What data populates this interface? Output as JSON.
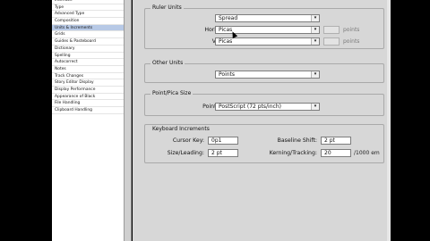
{
  "sidebar": {
    "items": [
      {
        "label": "Interface",
        "selected": false
      },
      {
        "label": "Type",
        "selected": false
      },
      {
        "label": "Advanced Type",
        "selected": false
      },
      {
        "label": "Composition",
        "selected": false
      },
      {
        "label": "Units & Increments",
        "selected": true
      },
      {
        "label": "Grids",
        "selected": false
      },
      {
        "label": "Guides & Pasteboard",
        "selected": false
      },
      {
        "label": "Dictionary",
        "selected": false
      },
      {
        "label": "Spelling",
        "selected": false
      },
      {
        "label": "Autocorrect",
        "selected": false
      },
      {
        "label": "Notes",
        "selected": false
      },
      {
        "label": "Track Changes",
        "selected": false
      },
      {
        "label": "Story Editor Display",
        "selected": false
      },
      {
        "label": "Display Performance",
        "selected": false
      },
      {
        "label": "Appearance of Black",
        "selected": false
      },
      {
        "label": "File Handling",
        "selected": false
      },
      {
        "label": "Clipboard Handling",
        "selected": false
      }
    ]
  },
  "ruler_units": {
    "title": "Ruler Units",
    "origin_label": "Origin:",
    "origin_value": "Spread",
    "horizontal_label": "Horizontal:",
    "horizontal_value": "Picas",
    "horizontal_unit": "points",
    "vertical_label": "Vertical:",
    "vertical_value": "Picas",
    "vertical_unit": "points"
  },
  "other_units": {
    "title": "Other Units",
    "stroke_label": "Stroke:",
    "stroke_value": "Points"
  },
  "point_pica": {
    "title": "Point/Pica Size",
    "points_inch_label": "Points/Inch:",
    "points_inch_value": "PostScript (72 pts/inch)"
  },
  "keyboard": {
    "title": "Keyboard Increments",
    "cursor_key_label": "Cursor Key:",
    "cursor_key_value": "0p1",
    "baseline_shift_label": "Baseline Shift:",
    "baseline_shift_value": "2 pt",
    "size_leading_label": "Size/Leading:",
    "size_leading_value": "2 pt",
    "kerning_label": "Kerning/Tracking:",
    "kerning_value": "20",
    "kerning_unit": "/1000 em"
  },
  "colors": {
    "panel_bg": "#d7d7d7",
    "selected_row": "#b7c9e6"
  }
}
